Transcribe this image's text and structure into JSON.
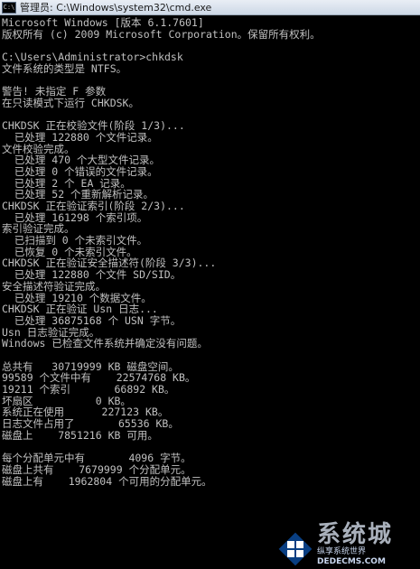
{
  "window": {
    "title": "管理员: C:\\Windows\\system32\\cmd.exe",
    "icon_label": "C:\\"
  },
  "console": {
    "lines": [
      "Microsoft Windows [版本 6.1.7601]",
      "版权所有 (c) 2009 Microsoft Corporation。保留所有权利。",
      "",
      "C:\\Users\\Administrator>chkdsk",
      "文件系统的类型是 NTFS。",
      "",
      "警告! 未指定 F 参数",
      "在只读模式下运行 CHKDSK。",
      "",
      "CHKDSK 正在校验文件(阶段 1/3)...",
      "  已处理 122880 个文件记录。",
      "文件校验完成。",
      "  已处理 470 个大型文件记录。",
      "  已处理 0 个错误的文件记录。",
      "  已处理 2 个 EA 记录。",
      "  已处理 52 个重新解析记录。",
      "CHKDSK 正在验证索引(阶段 2/3)...",
      "  已处理 161298 个索引项。",
      "索引验证完成。",
      "  已扫描到 0 个未索引文件。",
      "  已恢复 0 个未索引文件。",
      "CHKDSK 正在验证安全描述符(阶段 3/3)...",
      "  已处理 122880 个文件 SD/SID。",
      "安全描述符验证完成。",
      "  已处理 19210 个数据文件。",
      "CHKDSK 正在验证 Usn 日志...",
      "  已处理 36875168 个 USN 字节。",
      "Usn 日志验证完成。",
      "Windows 已检查文件系统并确定没有问题。",
      "",
      "总共有   30719999 KB 磁盘空间。",
      "99589 个文件中有    22574768 KB。",
      "19211 个索引       66892 KB。",
      "坏扇区          0 KB。",
      "系统正在使用      227123 KB。",
      "日志文件占用了       65536 KB。",
      "磁盘上    7851216 KB 可用。",
      "",
      "每个分配单元中有       4096 字节。",
      "磁盘上共有    7679999 个分配单元。",
      "磁盘上有    1962804 个可用的分配单元。"
    ]
  },
  "watermark": {
    "brand": "系统城",
    "site": "纵享系统世界",
    "url": "DEDECMS.COM",
    "icon": "windows-logo-icon"
  },
  "colors": {
    "console_bg": "#000000",
    "console_text": "#c0c0c0",
    "titlebar": "#dbe4ef"
  }
}
